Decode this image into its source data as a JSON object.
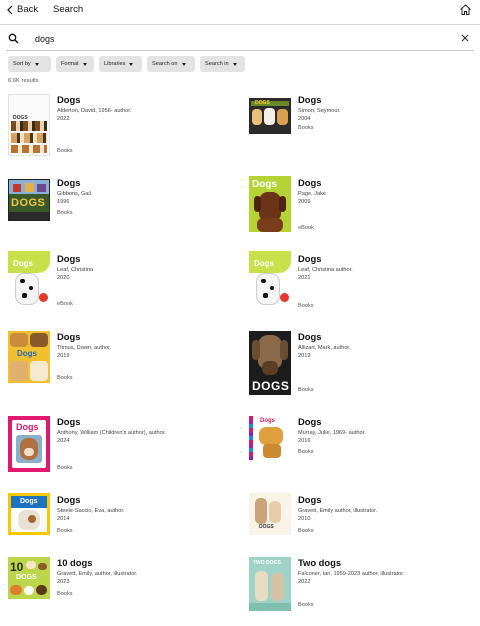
{
  "topbar": {
    "back_label": "Back",
    "title": "Search",
    "back_icon": "chevron-left-icon",
    "home_icon": "home-icon"
  },
  "search": {
    "value": "dogs",
    "placeholder": "",
    "search_icon": "search-icon",
    "clear_icon": "close-icon"
  },
  "filters": [
    "Sort by",
    "Format",
    "Libraries",
    "Search on",
    "Search in"
  ],
  "results_count": "6.6K results",
  "results": [
    {
      "title": "Dogs",
      "author": "Alderton, David, 1956- author.",
      "year": "2022",
      "format": "Books"
    },
    {
      "title": "Dogs",
      "author": "Simon, Seymour.",
      "year": "2004",
      "format": "Books"
    },
    {
      "title": "Dogs",
      "author": "Gibbons, Gail.",
      "year": "1996",
      "format": "Books"
    },
    {
      "title": "Dogs",
      "author": "Page, Jake",
      "year": "2009",
      "format": "eBook"
    },
    {
      "title": "Dogs",
      "author": "Leaf, Christina",
      "year": "2020",
      "format": "eBook"
    },
    {
      "title": "Dogs",
      "author": "Leaf, Christina author.",
      "year": "2021",
      "format": "Books"
    },
    {
      "title": "Dogs",
      "author": "Titmus, Dawn, author.",
      "year": "2019",
      "format": "Books"
    },
    {
      "title": "Dogs",
      "author": "Allizart, Mark, author.",
      "year": "2019",
      "format": "Books"
    },
    {
      "title": "Dogs",
      "author": "Anthony, William (Children's author), author.",
      "year": "2024",
      "format": "Books"
    },
    {
      "title": "Dogs",
      "author": "Murray, Julie, 1969- author.",
      "year": "2016",
      "format": "Books"
    },
    {
      "title": "Dogs",
      "author": "Steele-Saccio, Eva, author.",
      "year": "2014",
      "format": "Books"
    },
    {
      "title": "Dogs",
      "author": "Gravett, Emily author, illustrator.",
      "year": "2010",
      "format": "Books"
    },
    {
      "title": "10 dogs",
      "author": "Gravett, Emily, author, illustrator.",
      "year": "2023",
      "format": "Books"
    },
    {
      "title": "Two dogs",
      "author": "Falconer, Ian, 1959-2023 author, illustrator.",
      "year": "2022",
      "format": "Books"
    }
  ],
  "cover_art": {
    "r0": "DOGS",
    "r1": "DOGS",
    "r2": "DOGS",
    "r3": "Dogs",
    "r4": "Dogs",
    "r5": "Dogs",
    "r6": "Dogs",
    "r7": "DOGS",
    "r8": "Dogs",
    "r9": "Dogs",
    "r10": "Dogs",
    "r11": "DOGS",
    "r12": "DOGS",
    "r13": "TWO DOGS"
  },
  "colors": {
    "chip_bg": "#e3e3e3",
    "divider": "#d6d6d6",
    "text": "#111111"
  }
}
